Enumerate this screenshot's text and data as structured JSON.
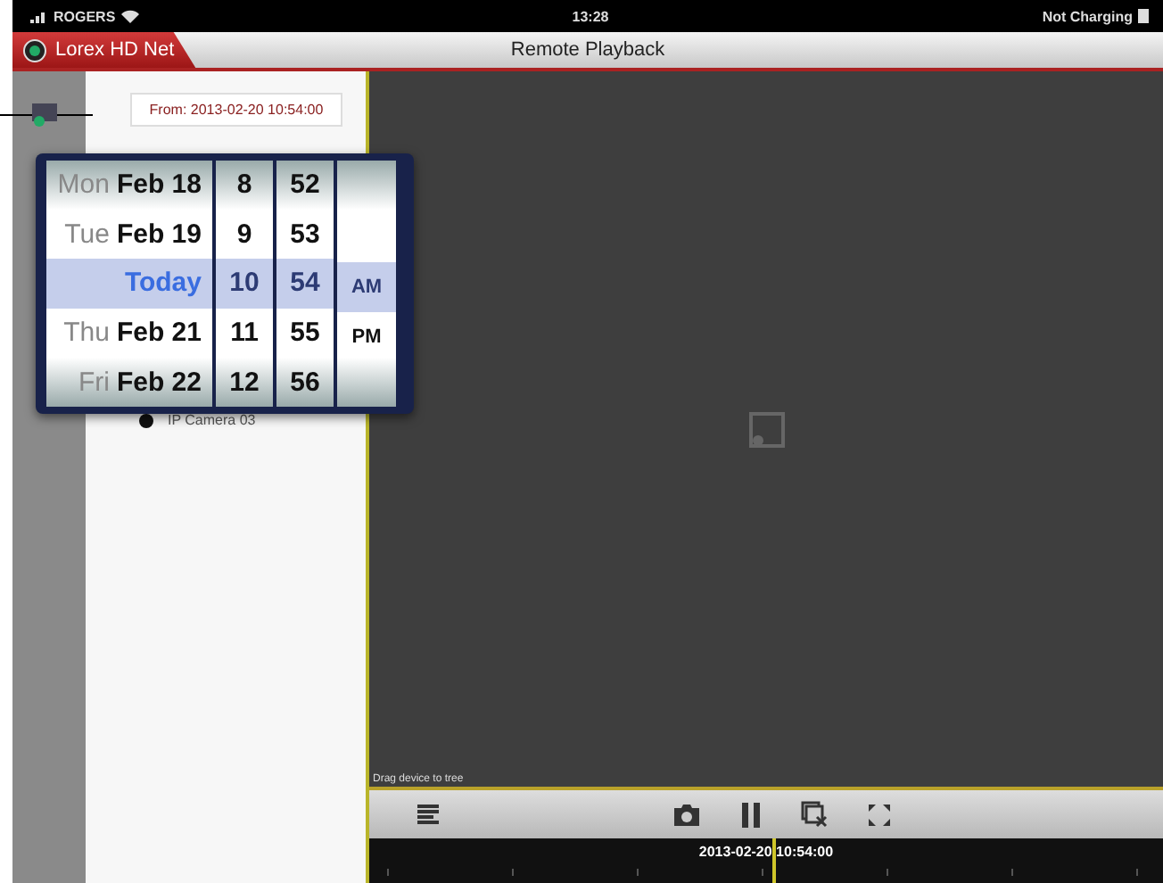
{
  "status_bar": {
    "carrier": "ROGERS",
    "time": "13:28",
    "battery": "Not Charging"
  },
  "nav_bar": {
    "back_button": "Lorex HD Net",
    "title": "Remote Playback"
  },
  "from_field": {
    "value": "From: 2013-02-20 10:54:00"
  },
  "device_list": [
    {
      "label": "IP Camera 03"
    }
  ],
  "picker": {
    "columns": [
      {
        "kind": "day",
        "items": [
          {
            "prefix": "Mon",
            "label": "Feb 18",
            "selected": false
          },
          {
            "prefix": "Tue",
            "label": "Feb 19",
            "selected": false
          },
          {
            "label": "Today",
            "selected": true
          },
          {
            "prefix": "Thu",
            "label": "Feb 21",
            "selected": false
          },
          {
            "prefix": "Fri",
            "label": "Feb 22",
            "selected": false
          }
        ]
      },
      {
        "kind": "number",
        "items": [
          {
            "label": "8",
            "selected": false
          },
          {
            "label": "9",
            "selected": false
          },
          {
            "label": "10",
            "selected": true
          },
          {
            "label": "11",
            "selected": false
          },
          {
            "label": "12",
            "selected": false
          }
        ]
      },
      {
        "kind": "number",
        "items": [
          {
            "label": "52",
            "selected": false
          },
          {
            "label": "53",
            "selected": false
          },
          {
            "label": "54",
            "selected": true
          },
          {
            "label": "55",
            "selected": false
          },
          {
            "label": "56",
            "selected": false
          }
        ]
      },
      {
        "kind": "ampm",
        "items": [
          {
            "label": "AM",
            "selected": true
          },
          {
            "label": "PM",
            "selected": false
          }
        ]
      }
    ]
  },
  "video": {
    "hint": "Drag device to tree"
  },
  "toolbar": {
    "buttons": [
      {
        "kind": "list"
      },
      {
        "kind": "camera"
      },
      {
        "kind": "pause"
      },
      {
        "kind": "close-window"
      },
      {
        "kind": "fullscreen"
      }
    ]
  },
  "timeline": {
    "current": "2013-02-20 10:54:00"
  }
}
